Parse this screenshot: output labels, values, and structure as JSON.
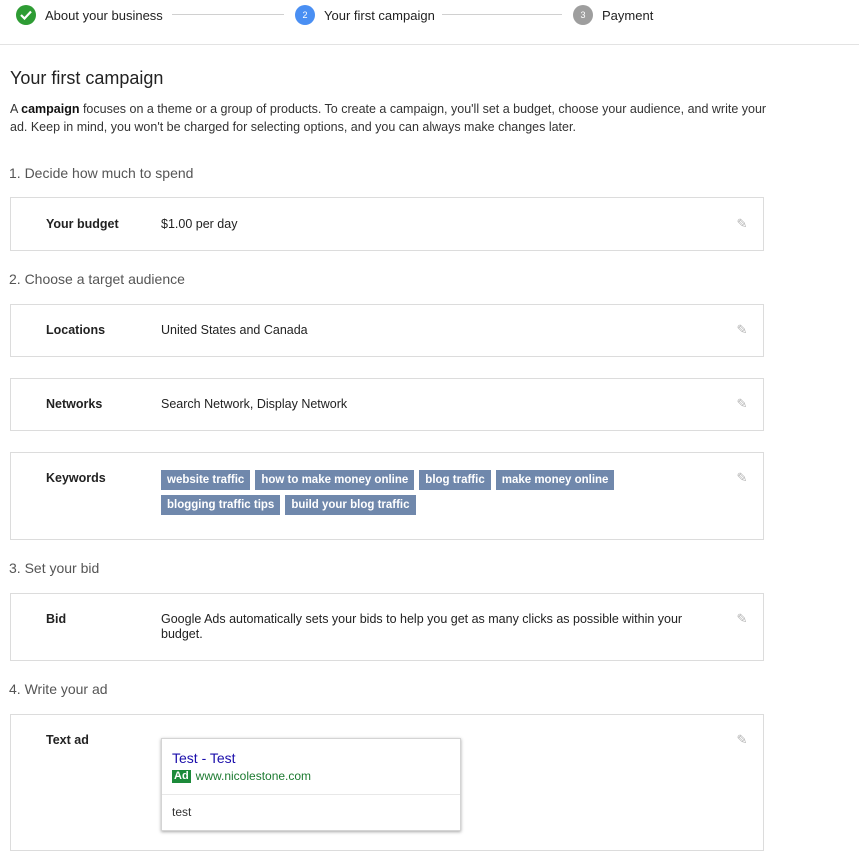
{
  "stepper": {
    "steps": [
      {
        "number": "",
        "label": "About your business",
        "state": "complete"
      },
      {
        "number": "2",
        "label": "Your first campaign",
        "state": "active"
      },
      {
        "number": "3",
        "label": "Payment",
        "state": "pending"
      }
    ]
  },
  "page": {
    "title": "Your first campaign",
    "intro_pre": "A ",
    "intro_bold": "campaign",
    "intro_post": " focuses on a theme or a group of products. To create a campaign, you'll set a budget, choose your audience, and write your ad. Keep in mind, you won't be charged for selecting options, and you can always make changes later."
  },
  "sections": {
    "spend": {
      "heading": "1. Decide how much to spend",
      "budget_label": "Your budget",
      "budget_value": "$1.00 per day"
    },
    "audience": {
      "heading": "2. Choose a target audience",
      "locations_label": "Locations",
      "locations_value": "United States and Canada",
      "networks_label": "Networks",
      "networks_value": "Search Network, Display Network",
      "keywords_label": "Keywords",
      "keywords": [
        "website traffic",
        "how to make money online",
        "blog traffic",
        "make money online",
        "blogging traffic tips",
        "build your blog traffic"
      ]
    },
    "bid": {
      "heading": "3. Set your bid",
      "label": "Bid",
      "value": "Google Ads automatically sets your bids to help you get as many clicks as possible within your budget."
    },
    "ad": {
      "heading": "4. Write your ad",
      "label": "Text ad",
      "headline": "Test - Test",
      "badge": "Ad",
      "url": "www.nicolestone.com",
      "description": "test"
    }
  },
  "colors": {
    "complete": "#2e9c34",
    "active": "#4a8ff3",
    "pending": "#9e9e9e",
    "chip": "#7088ac"
  },
  "icons": {
    "edit": "pencil-icon",
    "complete": "checkmark-icon"
  }
}
